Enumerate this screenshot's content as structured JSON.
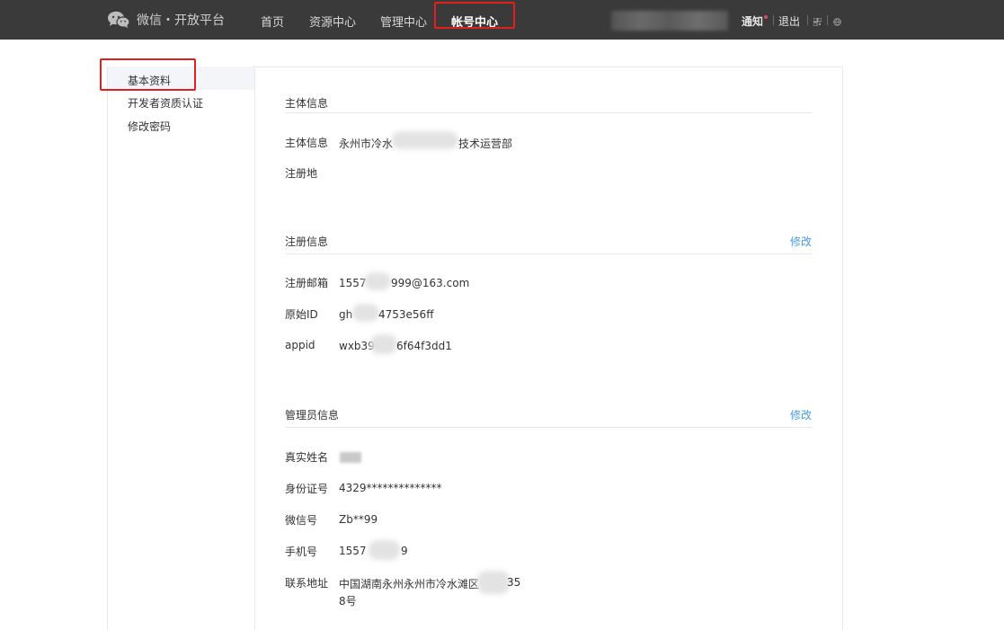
{
  "header": {
    "brand": "微信・开放平台",
    "nav": [
      "首页",
      "资源中心",
      "管理中心",
      "帐号中心"
    ],
    "active_nav": "帐号中心",
    "notice": "通知",
    "logout": "退出"
  },
  "sidebar": {
    "items": [
      {
        "label": "基本资料",
        "active": true
      },
      {
        "label": "开发者资质认证"
      },
      {
        "label": "修改密码"
      }
    ]
  },
  "sections": {
    "subject": {
      "title": "主体信息",
      "rows": [
        {
          "label": "主体信息",
          "value_prefix": "永州市冷水",
          "value_suffix": "技术运营部"
        },
        {
          "label": "注册地",
          "value": ""
        }
      ]
    },
    "registration": {
      "title": "注册信息",
      "edit": "修改",
      "rows": [
        {
          "label": "注册邮箱",
          "value_prefix": "1557",
          "value_suffix": "999@163.com"
        },
        {
          "label": "原始ID",
          "value_prefix": "gh",
          "value_suffix": "4753e56ff"
        },
        {
          "label": "appid",
          "value_prefix": "wxb39",
          "value_suffix": "6f64f3dd1"
        }
      ]
    },
    "admin": {
      "title": "管理员信息",
      "edit": "修改",
      "rows": [
        {
          "label": "真实姓名",
          "value": ""
        },
        {
          "label": "身份证号",
          "value": "4329**************"
        },
        {
          "label": "微信号",
          "value": "Zb**99"
        },
        {
          "label": "手机号",
          "value_prefix": "1557",
          "value_suffix": "9"
        },
        {
          "label": "联系地址",
          "value_line1_prefix": "中国湖南永州永州市冷水滩区",
          "value_line1_suffix": "35",
          "value_line2": "8号"
        }
      ]
    }
  },
  "colors": {
    "topbar": "#3a3a3a",
    "link": "#459ae9",
    "highlight": "#e0201e"
  },
  "icons": [
    "wechat-logo-icon",
    "qrcode-icon",
    "globe-icon"
  ]
}
